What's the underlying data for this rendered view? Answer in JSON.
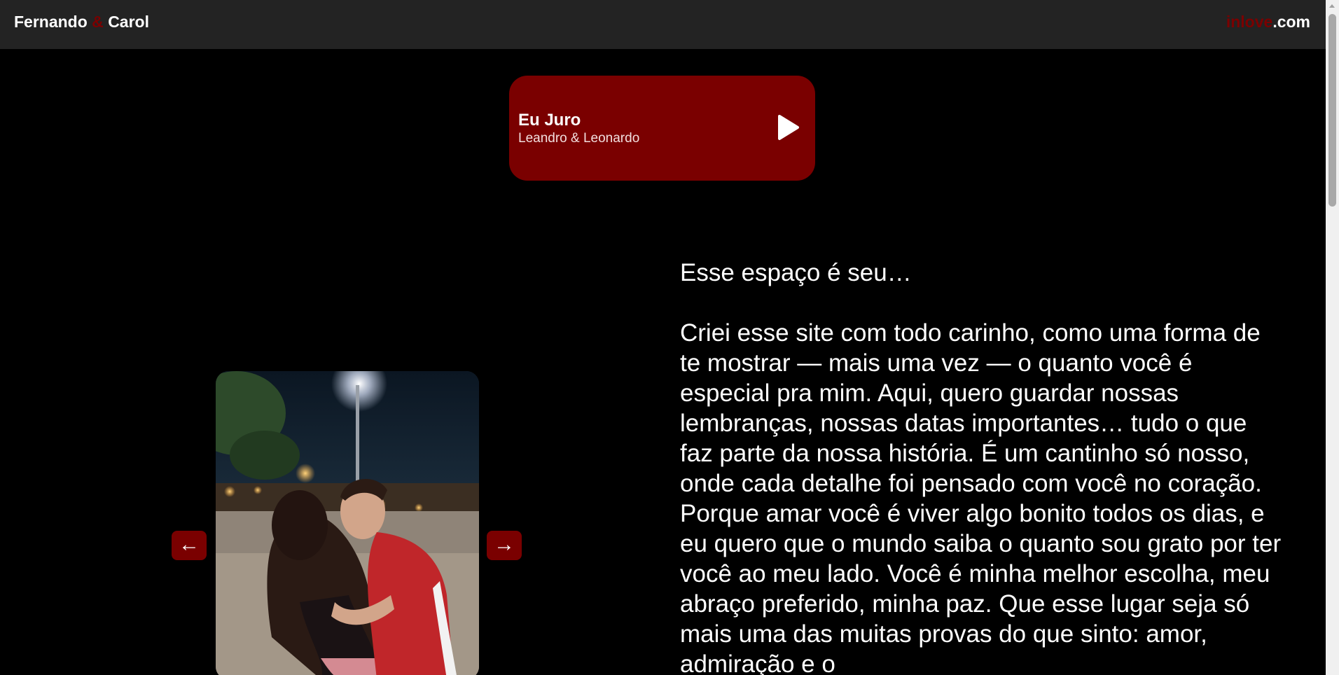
{
  "header": {
    "brand_name_1": "Fernando",
    "brand_amp": "&",
    "brand_name_2": "Carol",
    "site_accent": "inlove",
    "site_suffix": ".com"
  },
  "music": {
    "title": "Eu Juro",
    "artist": "Leandro & Leonardo",
    "play_icon": "play-icon"
  },
  "carousel": {
    "prev_label": "←",
    "next_label": "→"
  },
  "message": {
    "heading": "Esse espaço é seu…",
    "body": "Criei esse site com todo carinho, como uma forma de te mostrar — mais uma vez — o quanto você é especial pra mim. Aqui, quero guardar nossas lembranças, nossas datas importantes… tudo o que faz parte da nossa história. É um cantinho só nosso, onde cada detalhe foi pensado com você no coração. Porque amar você é viver algo bonito todos os dias, e eu quero que o mundo saiba o quanto sou grato por ter você ao meu lado. Você é minha melhor escolha, meu abraço preferido, minha paz. Que esse lugar seja só mais uma das muitas provas do que sinto: amor, admiração e o"
  },
  "colors": {
    "accent": "#7a0000",
    "background": "#000000",
    "header_bg": "#232323"
  }
}
